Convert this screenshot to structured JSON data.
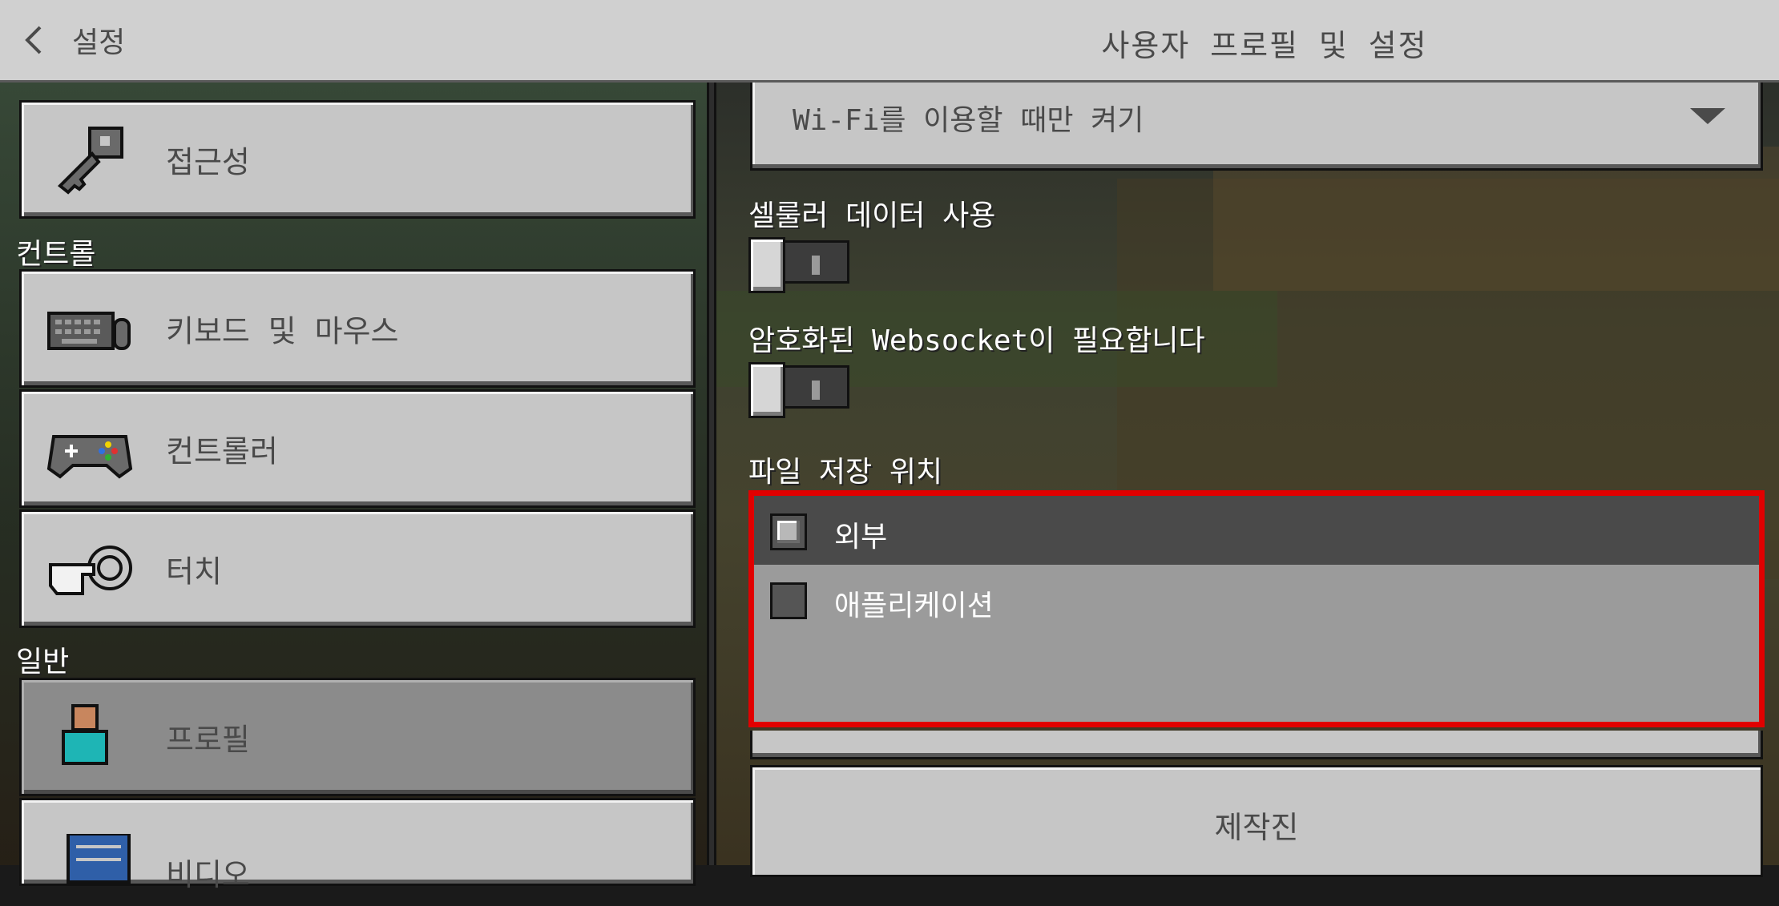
{
  "header": {
    "back_label": "설정",
    "title": "사용자 프로필 및 설정"
  },
  "sidebar": {
    "sections": [
      {
        "label": "컨트롤"
      },
      {
        "label": "일반"
      }
    ],
    "items": [
      {
        "label": "접근성",
        "icon": "key-icon"
      },
      {
        "label": "키보드 및 마우스",
        "icon": "keyboard-mouse-icon"
      },
      {
        "label": "컨트롤러",
        "icon": "gamepad-icon"
      },
      {
        "label": "터치",
        "icon": "touch-hand-icon"
      },
      {
        "label": "프로필",
        "icon": "profile-icon",
        "active": true
      },
      {
        "label": "비디오",
        "icon": "video-settings-icon"
      }
    ]
  },
  "settings": {
    "dropdown_value": "Wi-Fi를 이용할 때만 켜기",
    "cellular_label": "셀룰러 데이터 사용",
    "cellular_on": false,
    "websocket_label": "암호화된 Websocket이 필요합니다",
    "websocket_on": false,
    "storage_label": "파일 저장 위치",
    "storage_options": [
      {
        "label": "외부",
        "selected": true
      },
      {
        "label": "애플리케이션",
        "selected": false
      }
    ],
    "credits_label": "제작진"
  },
  "colors": {
    "highlight_border": "#e10000",
    "button_gray": "#c6c6c6",
    "header_gray": "#d0d0d0"
  }
}
